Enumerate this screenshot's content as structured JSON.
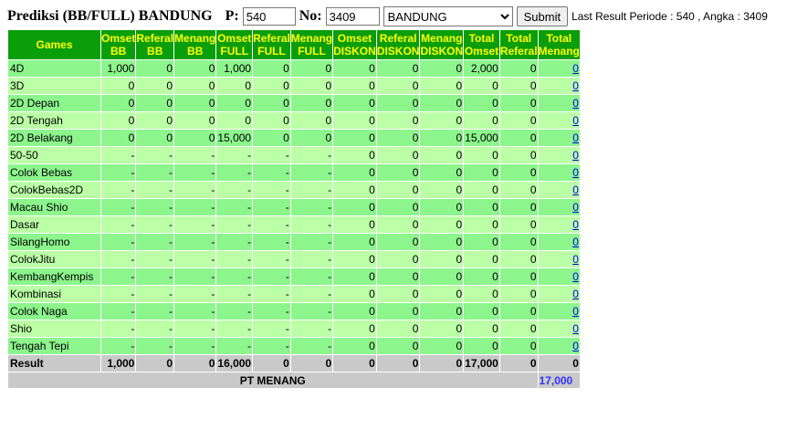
{
  "header": {
    "title": "Prediksi (BB/FULL) BANDUNG",
    "p_label": "P:",
    "p_value": "540",
    "no_label": "No:",
    "no_value": "3409",
    "select_value": "BANDUNG",
    "submit_label": "Submit",
    "last_result": "Last Result Periode : 540 , Angka : 3409"
  },
  "table": {
    "columns": [
      [
        "Games"
      ],
      [
        "Omset",
        "BB"
      ],
      [
        "Referal",
        "BB"
      ],
      [
        "Menang",
        "BB"
      ],
      [
        "Omset",
        "FULL"
      ],
      [
        "Referal",
        "FULL"
      ],
      [
        "Menang",
        "FULL"
      ],
      [
        "Omset",
        "DISKON"
      ],
      [
        "Referal",
        "DISKON"
      ],
      [
        "Menang",
        "DISKON"
      ],
      [
        "Total",
        "Omset"
      ],
      [
        "Total",
        "Referal"
      ],
      [
        "Total",
        "Menang"
      ]
    ],
    "rows": [
      {
        "game": "4D",
        "cells": [
          "1,000",
          "0",
          "0",
          "1,000",
          "0",
          "0",
          "0",
          "0",
          "0",
          "2,000",
          "0"
        ],
        "total_menang": "0"
      },
      {
        "game": "3D",
        "cells": [
          "0",
          "0",
          "0",
          "0",
          "0",
          "0",
          "0",
          "0",
          "0",
          "0",
          "0"
        ],
        "total_menang": "0"
      },
      {
        "game": "2D Depan",
        "cells": [
          "0",
          "0",
          "0",
          "0",
          "0",
          "0",
          "0",
          "0",
          "0",
          "0",
          "0"
        ],
        "total_menang": "0"
      },
      {
        "game": "2D Tengah",
        "cells": [
          "0",
          "0",
          "0",
          "0",
          "0",
          "0",
          "0",
          "0",
          "0",
          "0",
          "0"
        ],
        "total_menang": "0"
      },
      {
        "game": "2D Belakang",
        "cells": [
          "0",
          "0",
          "0",
          "15,000",
          "0",
          "0",
          "0",
          "0",
          "0",
          "15,000",
          "0"
        ],
        "total_menang": "0"
      },
      {
        "game": "50-50",
        "cells": [
          "-",
          "-",
          "-",
          "-",
          "-",
          "-",
          "0",
          "0",
          "0",
          "0",
          "0"
        ],
        "total_menang": "0"
      },
      {
        "game": "Colok Bebas",
        "cells": [
          "-",
          "-",
          "-",
          "-",
          "-",
          "-",
          "0",
          "0",
          "0",
          "0",
          "0"
        ],
        "total_menang": "0"
      },
      {
        "game": "ColokBebas2D",
        "cells": [
          "-",
          "-",
          "-",
          "-",
          "-",
          "-",
          "0",
          "0",
          "0",
          "0",
          "0"
        ],
        "total_menang": "0"
      },
      {
        "game": "Macau Shio",
        "cells": [
          "-",
          "-",
          "-",
          "-",
          "-",
          "-",
          "0",
          "0",
          "0",
          "0",
          "0"
        ],
        "total_menang": "0"
      },
      {
        "game": "Dasar",
        "cells": [
          "-",
          "-",
          "-",
          "-",
          "-",
          "-",
          "0",
          "0",
          "0",
          "0",
          "0"
        ],
        "total_menang": "0"
      },
      {
        "game": "SilangHomo",
        "cells": [
          "-",
          "-",
          "-",
          "-",
          "-",
          "-",
          "0",
          "0",
          "0",
          "0",
          "0"
        ],
        "total_menang": "0"
      },
      {
        "game": "ColokJitu",
        "cells": [
          "-",
          "-",
          "-",
          "-",
          "-",
          "-",
          "0",
          "0",
          "0",
          "0",
          "0"
        ],
        "total_menang": "0"
      },
      {
        "game": "KembangKempis",
        "cells": [
          "-",
          "-",
          "-",
          "-",
          "-",
          "-",
          "0",
          "0",
          "0",
          "0",
          "0"
        ],
        "total_menang": "0"
      },
      {
        "game": "Kombinasi",
        "cells": [
          "-",
          "-",
          "-",
          "-",
          "-",
          "-",
          "0",
          "0",
          "0",
          "0",
          "0"
        ],
        "total_menang": "0"
      },
      {
        "game": "Colok Naga",
        "cells": [
          "-",
          "-",
          "-",
          "-",
          "-",
          "-",
          "0",
          "0",
          "0",
          "0",
          "0"
        ],
        "total_menang": "0"
      },
      {
        "game": "Shio",
        "cells": [
          "-",
          "-",
          "-",
          "-",
          "-",
          "-",
          "0",
          "0",
          "0",
          "0",
          "0"
        ],
        "total_menang": "0"
      },
      {
        "game": "Tengah Tepi",
        "cells": [
          "-",
          "-",
          "-",
          "-",
          "-",
          "-",
          "0",
          "0",
          "0",
          "0",
          "0"
        ],
        "total_menang": "0"
      }
    ],
    "result": {
      "label": "Result",
      "cells": [
        "1,000",
        "0",
        "0",
        "16,000",
        "0",
        "0",
        "0",
        "0",
        "0",
        "17,000",
        "0",
        "0"
      ]
    },
    "pt": {
      "label": "PT MENANG",
      "value": "17,000"
    }
  },
  "colors": {
    "header_bg": "#0b9e0b",
    "header_text": "#ffff00",
    "row_dark": "#8cf58c",
    "row_light": "#bbffa6",
    "result_bg": "#c9c9c9",
    "pt_value": "#3333ff",
    "link": "#0000ee"
  }
}
